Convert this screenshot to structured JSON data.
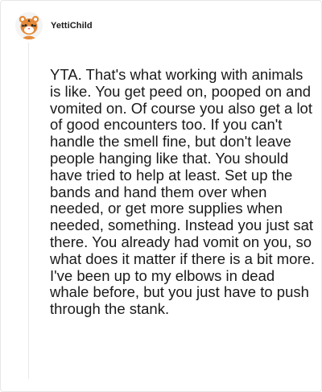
{
  "comment": {
    "username": "YettiChild",
    "avatar_icon": "tiger-avatar-icon",
    "body": "YTA. That's what working with animals is like. You get peed on, pooped on and vomited on. Of course you also get a lot of good encounters too. If you can't handle the smell fine, but don't leave people hanging like that. You should have tried to help at least. Set up the bands and hand them over when needed, or get more supplies when needed, something. Instead you just sat there. You already had vomit on you, so what does it matter if there is a bit more. I've been up to my elbows in dead whale before, but you just have to push through the stank."
  },
  "colors": {
    "text": "#1a1a1b",
    "border": "#e6e6e6",
    "thread_line": "#e8e8e8",
    "avatar_orange": "#e58a3a"
  }
}
